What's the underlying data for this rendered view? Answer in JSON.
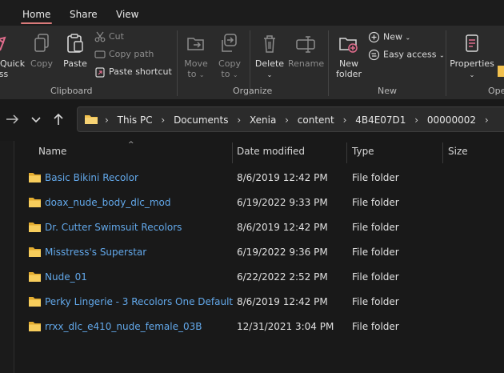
{
  "tabs": [
    {
      "label": "Home",
      "active": true
    },
    {
      "label": "Share",
      "active": false
    },
    {
      "label": "View",
      "active": false
    }
  ],
  "ribbon": {
    "quick_access": {
      "label_line1": "Quick",
      "label_line2": "ess"
    },
    "copy": "Copy",
    "paste": "Paste",
    "cut": "Cut",
    "copy_path": "Copy path",
    "paste_shortcut": "Paste shortcut",
    "clipboard_group": "Clipboard",
    "move_to_line1": "Move",
    "move_to_line2": "to",
    "copy_to_line1": "Copy",
    "copy_to_line2": "to",
    "delete": "Delete",
    "rename": "Rename",
    "organize_group": "Organize",
    "new_folder_line1": "New",
    "new_folder_line2": "folder",
    "new_item": "New",
    "easy_access": "Easy access",
    "new_group": "New",
    "properties": "Properties",
    "open_group": "Ope"
  },
  "address": {
    "crumbs": [
      "This PC",
      "Documents",
      "Xenia",
      "content",
      "4B4E07D1",
      "00000002"
    ]
  },
  "columns": {
    "name": "Name",
    "date_modified": "Date modified",
    "type": "Type",
    "size": "Size"
  },
  "files": [
    {
      "name": "Basic Bikini Recolor",
      "date": "8/6/2019 12:42 PM",
      "type": "File folder"
    },
    {
      "name": "doax_nude_body_dlc_mod",
      "date": "6/19/2022 9:33 PM",
      "type": "File folder"
    },
    {
      "name": "Dr. Cutter Swimsuit Recolors",
      "date": "8/6/2019 12:42 PM",
      "type": "File folder"
    },
    {
      "name": "Misstress's Superstar",
      "date": "6/19/2022 9:36 PM",
      "type": "File folder"
    },
    {
      "name": "Nude_01",
      "date": "6/22/2022 2:52 PM",
      "type": "File folder"
    },
    {
      "name": "Perky Lingerie - 3 Recolors One Default",
      "date": "8/6/2019 12:42 PM",
      "type": "File folder"
    },
    {
      "name": "rrxx_dlc_e410_nude_female_03B",
      "date": "12/31/2021 3:04 PM",
      "type": "File folder"
    }
  ],
  "colors": {
    "accent_tab": "#d97a7a",
    "link": "#62a8ea",
    "folder": "#f2c14e",
    "background": "#191919",
    "ribbon": "#2b2b2b"
  }
}
